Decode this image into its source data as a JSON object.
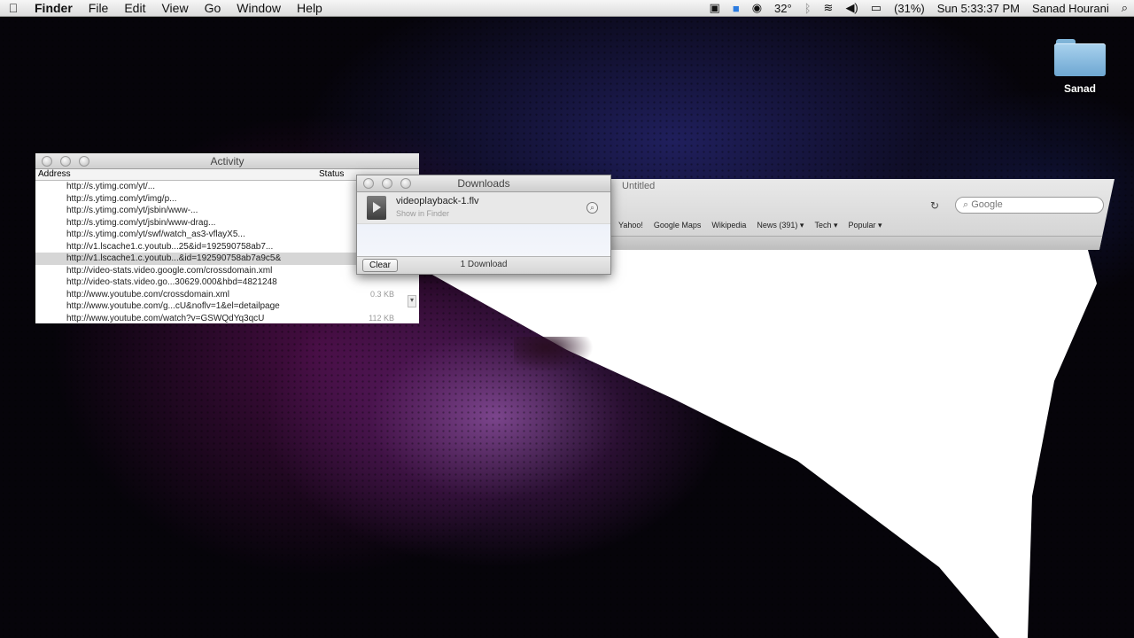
{
  "menubar": {
    "apple": "",
    "items": [
      "Finder",
      "File",
      "Edit",
      "View",
      "Go",
      "Window",
      "Help"
    ],
    "status": {
      "temperature": "32°",
      "battery": "(31%)",
      "clock": "Sun 5:33:37 PM",
      "user": "Sanad Hourani"
    }
  },
  "desktop": {
    "folder_label": "Sanad"
  },
  "safari": {
    "window_title": "Untitled",
    "search_placeholder": "Google",
    "bookmarks": [
      "Yahoo!",
      "Google Maps",
      "Wikipedia",
      "News (391) ▾",
      "Tech ▾",
      "Popular ▾"
    ]
  },
  "activity": {
    "title": "Activity",
    "col_address": "Address",
    "col_status": "Status",
    "rows": [
      {
        "url": "http://s.ytimg.com/yt/...",
        "status": ""
      },
      {
        "url": "http://s.ytimg.com/yt/img/p...",
        "status": ""
      },
      {
        "url": "http://s.ytimg.com/yt/jsbin/www-...",
        "status": ""
      },
      {
        "url": "http://s.ytimg.com/yt/jsbin/www-drag...",
        "status": ""
      },
      {
        "url": "http://s.ytimg.com/yt/swf/watch_as3-vflayX5...",
        "status": ""
      },
      {
        "url": "http://v1.lscache1.c.youtub...25&id=192590758ab7...",
        "status": ""
      },
      {
        "url": "http://v1.lscache1.c.youtub...&id=192590758ab7a9c5&",
        "status": ""
      },
      {
        "url": "http://video-stats.video.google.com/crossdomain.xml",
        "status": ""
      },
      {
        "url": "http://video-stats.video.go...30629.000&hbd=4821248",
        "status": ""
      },
      {
        "url": "http://www.youtube.com/crossdomain.xml",
        "status": "0.3 KB"
      },
      {
        "url": "http://www.youtube.com/g...cU&noflv=1&el=detailpage",
        "status": ""
      },
      {
        "url": "http://www.youtube.com/watch?v=GSWQdYq3qcU",
        "status": "112 KB"
      }
    ]
  },
  "downloads": {
    "title": "Downloads",
    "file_name": "videoplayback-1.flv",
    "file_sub": "Show in Finder",
    "clear_label": "Clear",
    "count_label": "1 Download"
  }
}
